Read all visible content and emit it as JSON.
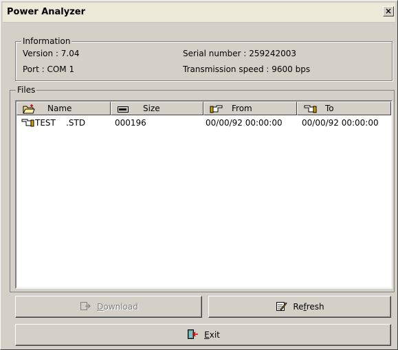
{
  "window": {
    "title": "Power Analyzer",
    "close_glyph": "×"
  },
  "information": {
    "legend": "Information",
    "version": "Version : 7.04",
    "port": "Port : COM 1",
    "serial_number": "Serial number : 259242003",
    "transmission_speed": "Transmission speed : 9600 bps"
  },
  "files": {
    "legend": "Files",
    "columns": [
      {
        "label": "Name",
        "icon": "folder-new-icon"
      },
      {
        "label": "Size",
        "icon": "drive-icon"
      },
      {
        "label": "From",
        "icon": "hand-pointing-right-icon"
      },
      {
        "label": "To",
        "icon": "hand-pointing-left-icon"
      }
    ],
    "rows": [
      {
        "icon": "hand-pointing-left-icon",
        "name": "TEST    .STD",
        "size": "000196",
        "from": "00/00/92 00:00:00",
        "to": "00/00/92 00:00:00"
      }
    ]
  },
  "buttons": {
    "download": {
      "prefix": "",
      "accel": "D",
      "rest": "ownload",
      "enabled": false,
      "icon": "download-icon"
    },
    "refresh": {
      "prefix": "Re",
      "accel": "f",
      "rest": "resh",
      "enabled": true,
      "icon": "refresh-icon"
    },
    "exit": {
      "prefix": "",
      "accel": "E",
      "rest": "xit",
      "enabled": true,
      "icon": "exit-door-icon"
    }
  }
}
